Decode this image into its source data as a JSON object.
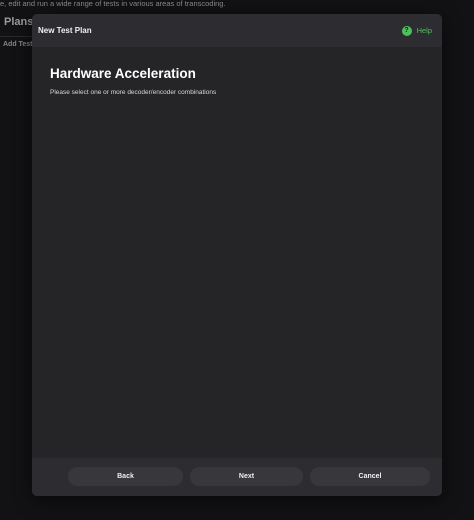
{
  "background": {
    "description": "e, edit and run a wide range of tests in various areas of transcoding.",
    "heading": "Plans",
    "add_label": "Add Test"
  },
  "modal": {
    "title": "New Test Plan",
    "help_label": "Help",
    "help_icon": "question-circle-icon",
    "step_title": "Hardware Acceleration",
    "step_subtitle": "Please select one or more decoder/encoder combinations",
    "buttons": {
      "back": "Back",
      "next": "Next",
      "cancel": "Cancel"
    }
  },
  "colors": {
    "accent": "#4cc05a",
    "modal_bg": "#252528",
    "header_bg": "#2d2d31",
    "button_bg": "#37373c"
  }
}
